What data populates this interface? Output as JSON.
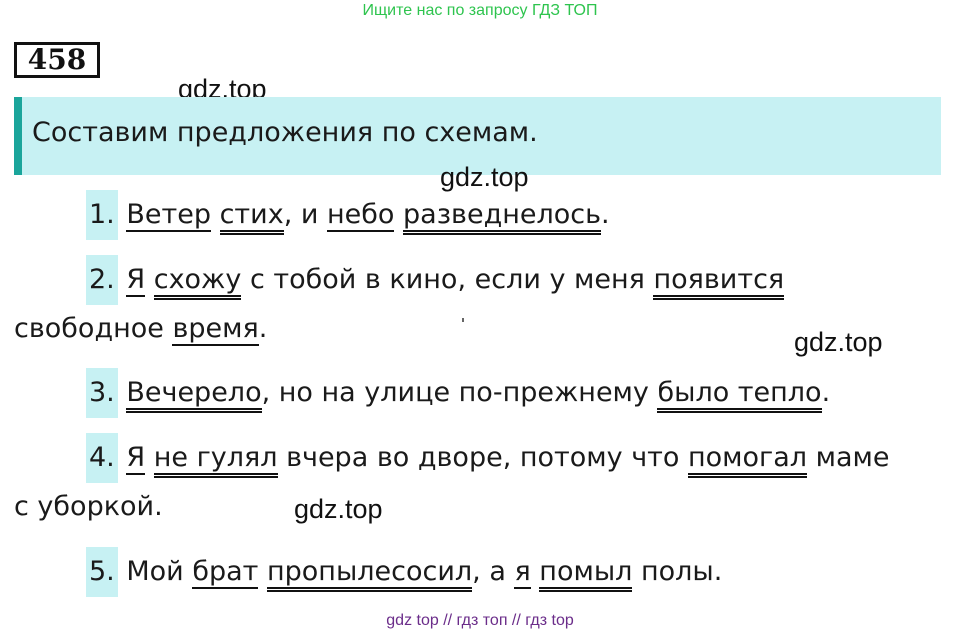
{
  "banner": "Ищите нас по запросу ГДЗ ТОП",
  "task_number": "458",
  "watermarks": [
    "gdz.top",
    "gdz.top",
    "gdz.top",
    "gdz.top"
  ],
  "instruction": "Составим предложения по схемам.",
  "sentences": {
    "s1": {
      "num": "1.",
      "w1": "Ветер",
      "w2": "стих",
      "t1": ", и ",
      "w3": "небо",
      "w4": "разведнелось",
      "t2": "."
    },
    "s2": {
      "num": "2.",
      "w1": "Я",
      "w2": "схожу",
      "t1": " с тобой в кино, если у меня ",
      "w3": "появится",
      "t2": "свободное ",
      "w4": "время",
      "t3": "."
    },
    "s3": {
      "num": "3.",
      "w1": "Вечерело",
      "t1": ", но на улице по-прежнему ",
      "w2": "было тепло",
      "t2": "."
    },
    "s4": {
      "num": "4.",
      "w1": "Я",
      "w2": "не гулял",
      "t1": " вчера во дворе, потому что ",
      "w3": "помогал",
      "t2": " маме",
      "t3": "с уборкой."
    },
    "s5": {
      "num": "5.",
      "t1": "Мой ",
      "w1": "брат",
      "w2": "пропылесосил",
      "t2": ", а ",
      "w3": "я",
      "w4": "помыл",
      "t3": " полы."
    }
  },
  "footer": "gdz top  //  гдз топ  //  гдз top"
}
